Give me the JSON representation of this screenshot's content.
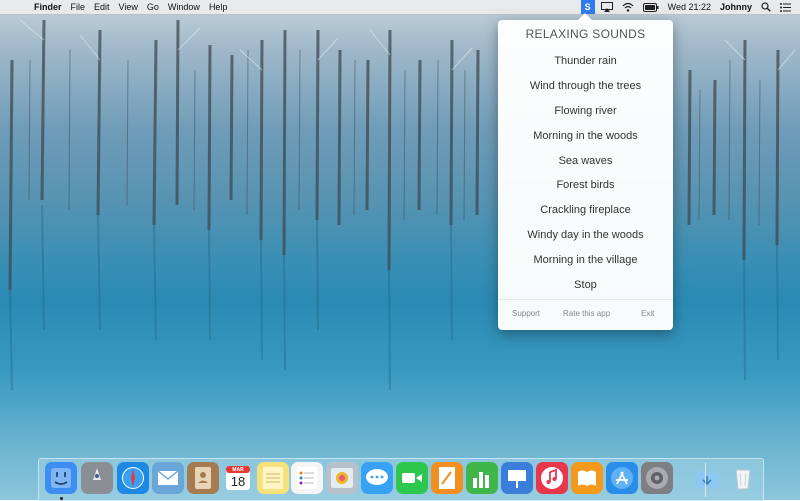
{
  "menubar": {
    "apple_glyph": "",
    "app_name": "Finder",
    "menus": [
      "File",
      "Edit",
      "View",
      "Go",
      "Window",
      "Help"
    ],
    "status_app_letter": "S",
    "clock": "Wed 21:22",
    "user": "Johnny"
  },
  "popup": {
    "title": "RELAXING SOUNDS",
    "items": [
      "Thunder rain",
      "Wind through the trees",
      "Flowing river",
      "Morning in the woods",
      "Sea waves",
      "Forest birds",
      "Crackling fireplace",
      "Windy day in the woods",
      "Morning in the village",
      "Stop"
    ],
    "footer": {
      "support": "Support",
      "rate": "Rate this app",
      "exit": "Exit"
    }
  },
  "dock": {
    "calendar_month": "MAR",
    "calendar_day": "18",
    "apps": [
      {
        "name": "Finder",
        "icon": "finder-icon",
        "color": "#3d8ef0"
      },
      {
        "name": "Launchpad",
        "icon": "launchpad-icon",
        "color": "#8a8f96"
      },
      {
        "name": "Safari",
        "icon": "safari-icon",
        "color": "#1e88e5"
      },
      {
        "name": "Mail",
        "icon": "mail-icon",
        "color": "#6aa6d8"
      },
      {
        "name": "Contacts",
        "icon": "contacts-icon",
        "color": "#a77b52"
      },
      {
        "name": "Calendar",
        "icon": "calendar-icon",
        "color": "#ffffff"
      },
      {
        "name": "Notes",
        "icon": "notes-icon",
        "color": "#f6e27a"
      },
      {
        "name": "Reminders",
        "icon": "reminders-icon",
        "color": "#f5f5f5"
      },
      {
        "name": "Photos",
        "icon": "photos-icon",
        "color": "#b6c1c9"
      },
      {
        "name": "Messages",
        "icon": "messages-icon",
        "color": "#37a2f4"
      },
      {
        "name": "FaceTime",
        "icon": "facetime-icon",
        "color": "#2cc84d"
      },
      {
        "name": "Pages",
        "icon": "pages-icon",
        "color": "#f18f1f"
      },
      {
        "name": "Numbers",
        "icon": "numbers-icon",
        "color": "#3fb54a"
      },
      {
        "name": "Keynote",
        "icon": "keynote-icon",
        "color": "#3b7ed9"
      },
      {
        "name": "iTunes",
        "icon": "itunes-icon",
        "color": "#e8364a"
      },
      {
        "name": "iBooks",
        "icon": "ibooks-icon",
        "color": "#f39a1c"
      },
      {
        "name": "App Store",
        "icon": "app-store-icon",
        "color": "#2a8ee8"
      },
      {
        "name": "System Preferences",
        "icon": "system-preferences-icon",
        "color": "#7d7f83"
      },
      {
        "name": "Downloads",
        "icon": "downloads-folder-icon",
        "color": "#74b8e6"
      },
      {
        "name": "Trash",
        "icon": "trash-icon",
        "color": "#e8edf0"
      }
    ]
  }
}
